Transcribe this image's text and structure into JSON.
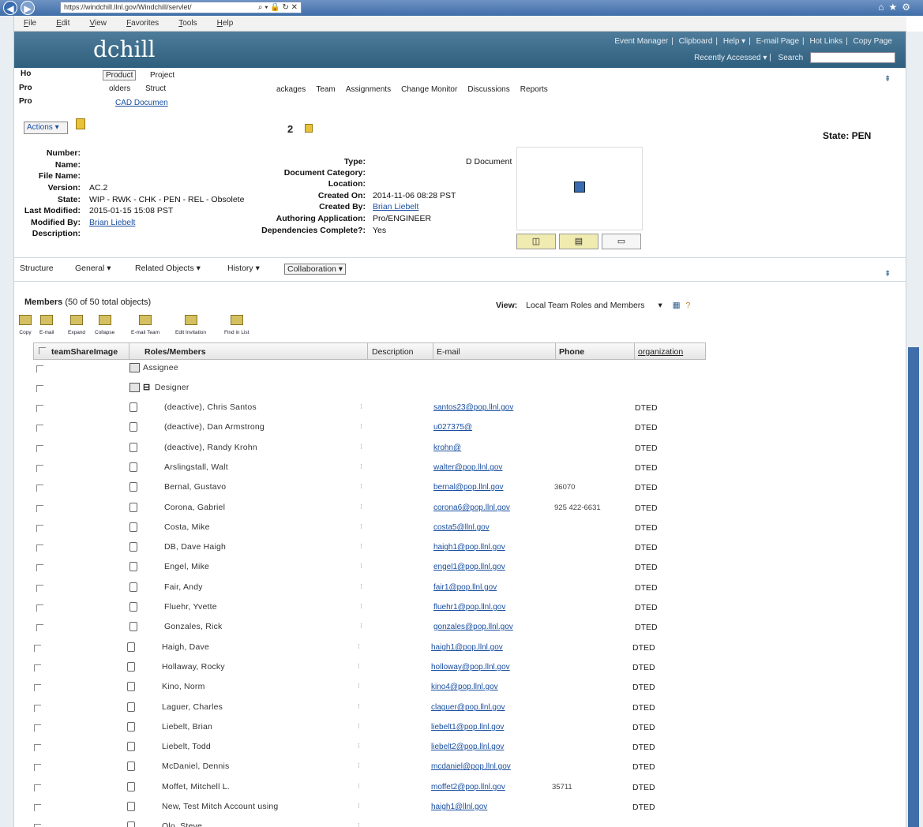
{
  "browser": {
    "url": "https://windchill.llnl.gov/Windchill/servlet/",
    "menu": [
      "File",
      "Edit",
      "View",
      "Favorites",
      "Tools",
      "Help"
    ]
  },
  "header": {
    "logo": "dchill",
    "links": [
      "Event Manager",
      "Clipboard",
      "Help ▾",
      "E-mail Page",
      "Hot Links",
      "Copy Page"
    ],
    "recently_accessed": "Recently Accessed ▾",
    "search_label": "Search"
  },
  "tabs": {
    "side": [
      "Ho",
      "Pro",
      "Pro"
    ],
    "top": [
      "Product",
      "Project",
      "olders",
      "Struct",
      "ackages",
      "Team",
      "Assignments",
      "Change Monitor",
      "Discussions",
      "Reports"
    ],
    "cad_link": "CAD Documen"
  },
  "actions": {
    "label": "Actions ▾"
  },
  "object": {
    "title_suffix": "2",
    "state_banner": "State: PEN"
  },
  "attributes_left": [
    {
      "label": "Number:",
      "value": ""
    },
    {
      "label": "Name:",
      "value": ""
    },
    {
      "label": "File Name:",
      "value": ""
    },
    {
      "label": "Version:",
      "value": "AC.2"
    },
    {
      "label": "State:",
      "value": "WIP - RWK - CHK - PEN - REL - Obsolete"
    },
    {
      "label": "Last Modified:",
      "value": "2015-01-15 15:08 PST"
    },
    {
      "label": "Modified By:",
      "value": "Brian Liebelt"
    },
    {
      "label": "Description:",
      "value": ""
    }
  ],
  "attributes_right": [
    {
      "label": "Type:",
      "value": "D Document"
    },
    {
      "label": "Document Category:",
      "value": ""
    },
    {
      "label": "Location:",
      "value": ""
    },
    {
      "label": "Created On:",
      "value": "2014-11-06 08:28 PST"
    },
    {
      "label": "Created By:",
      "value": "Brian Liebelt"
    },
    {
      "label": "Authoring Application:",
      "value": "Pro/ENGINEER"
    },
    {
      "label": "Dependencies Complete?:",
      "value": "Yes"
    }
  ],
  "nav2": [
    "Structure",
    "General ▾",
    "Related Objects ▾",
    "History ▾",
    "Collaboration ▾"
  ],
  "members": {
    "title": "Members",
    "count_text": "(50 of 50 total objects)",
    "view_label": "View:",
    "view_value": "Local Team Roles and Members",
    "toolbar": [
      "Copy",
      "E-mail",
      "Expand",
      "Collapse",
      "E-mail Team",
      "Edit Invitation",
      "Find in List"
    ],
    "columns": [
      "teamShareImage",
      "Roles/Members",
      "Description",
      "E-mail",
      "Phone",
      "organization"
    ],
    "groups": [
      "Assignee",
      "Designer"
    ],
    "rows": [
      {
        "name": "(deactive), Chris Santos",
        "email": "santos23@pop.llnl.gov",
        "phone": "",
        "org": "DTED"
      },
      {
        "name": "(deactive), Dan Armstrong",
        "email": "u027375@",
        "phone": "",
        "org": "DTED"
      },
      {
        "name": "(deactive), Randy Krohn",
        "email": "krohn@",
        "phone": "",
        "org": "DTED"
      },
      {
        "name": "Arslingstall, Walt",
        "email": "walter@pop.llnl.gov",
        "phone": "",
        "org": "DTED"
      },
      {
        "name": "Bernal, Gustavo",
        "email": "bernal@pop.llnl.gov",
        "phone": "36070",
        "org": "DTED"
      },
      {
        "name": "Corona, Gabriel",
        "email": "corona6@pop.llnl.gov",
        "phone": "925 422-6631",
        "org": "DTED"
      },
      {
        "name": "Costa, Mike",
        "email": "costa5@llnl.gov",
        "phone": "",
        "org": "DTED"
      },
      {
        "name": "DB, Dave Haigh",
        "email": "haigh1@pop.llnl.gov",
        "phone": "",
        "org": "DTED"
      },
      {
        "name": "Engel, Mike",
        "email": "engel1@pop.llnl.gov",
        "phone": "",
        "org": "DTED"
      },
      {
        "name": "Fair, Andy",
        "email": "fair1@pop.llnl.gov",
        "phone": "",
        "org": "DTED"
      },
      {
        "name": "Fluehr, Yvette",
        "email": "fluehr1@pop.llnl.gov",
        "phone": "",
        "org": "DTED"
      },
      {
        "name": "Gonzales, Rick",
        "email": "gonzales@pop.llnl.gov",
        "phone": "",
        "org": "DTED"
      },
      {
        "name": "Haigh, Dave",
        "email": "haigh1@pop.llnl.gov",
        "phone": "",
        "org": "DTED"
      },
      {
        "name": "Hollaway, Rocky",
        "email": "holloway@pop.llnl.gov",
        "phone": "",
        "org": "DTED"
      },
      {
        "name": "Kino, Norm",
        "email": "kino4@pop.llnl.gov",
        "phone": "",
        "org": "DTED"
      },
      {
        "name": "Laguer, Charles",
        "email": "claguer@pop.llnl.gov",
        "phone": "",
        "org": "DTED"
      },
      {
        "name": "Liebelt, Brian",
        "email": "liebelt1@pop.llnl.gov",
        "phone": "",
        "org": "DTED"
      },
      {
        "name": "Liebelt, Todd",
        "email": "liebelt2@pop.llnl.gov",
        "phone": "",
        "org": "DTED"
      },
      {
        "name": "McDaniel, Dennis",
        "email": "mcdaniel@pop.llnl.gov",
        "phone": "",
        "org": "DTED"
      },
      {
        "name": "Moffet, Mitchell L.",
        "email": "moffet2@pop.llnl.gov",
        "phone": "35711",
        "org": "DTED"
      },
      {
        "name": "New, Test Mitch Account using",
        "email": "haigh1@llnl.gov",
        "phone": "",
        "org": "DTED"
      },
      {
        "name": "Olo, Steve",
        "email": "",
        "phone": "",
        "org": ""
      }
    ]
  }
}
